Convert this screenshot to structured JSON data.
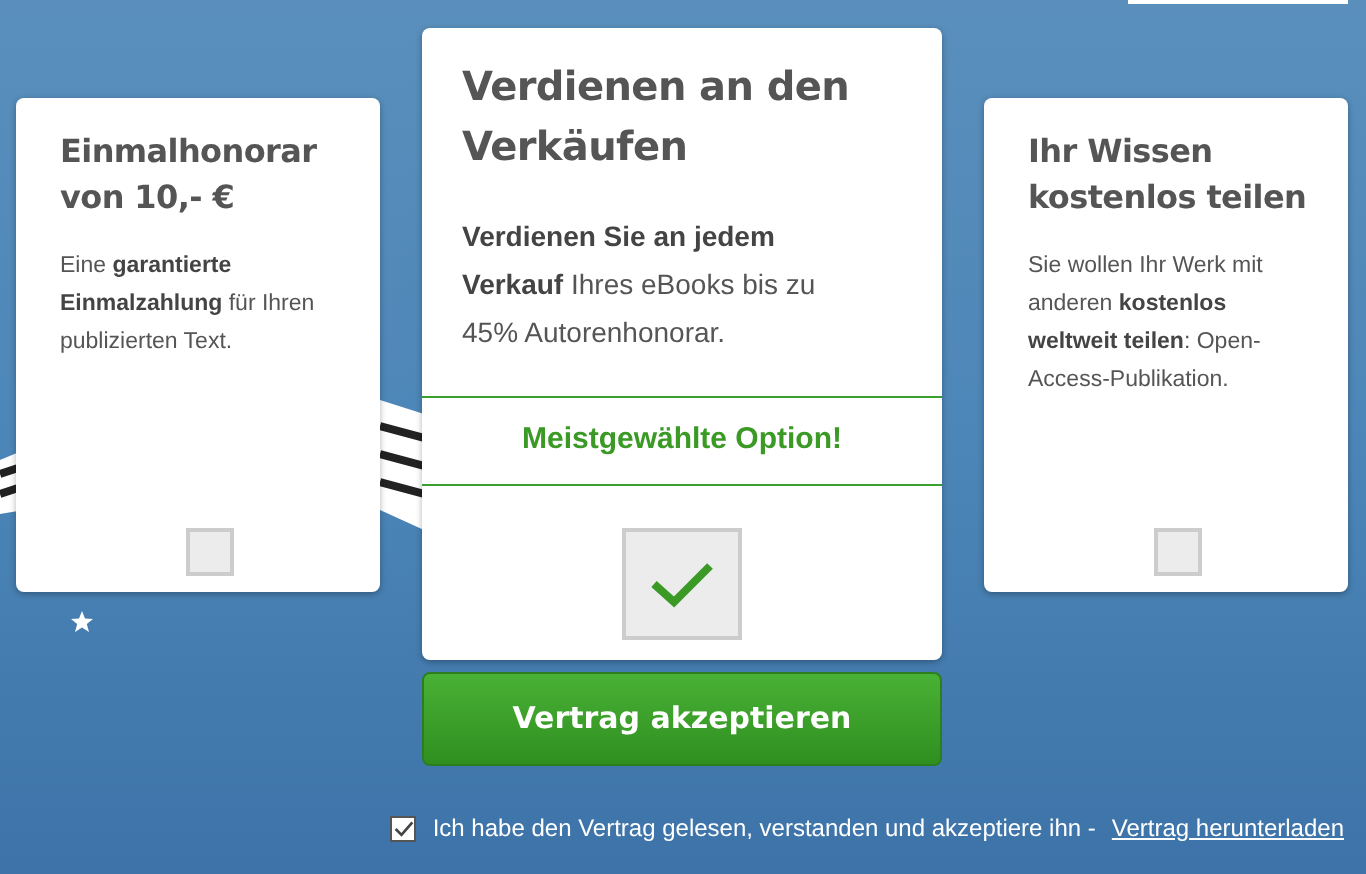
{
  "options": [
    {
      "kind": "standard",
      "title": "Einmalhonorar von 10,- €",
      "description": "Eine **garantierte Einmalzahlung** für Ihren publizierten Text.",
      "selected": false
    },
    {
      "kind": "featured",
      "title": "Verdienen an den Verkäufen",
      "description": "**Verdienen Sie an jedem Verkauf** Ihres eBooks bis zu 45% Autorenhonorar.",
      "badge": "Meistgewählte Option!",
      "selected": true
    },
    {
      "kind": "standard",
      "title": "Ihr Wissen kostenlos teilen",
      "description": "Sie wollen Ihr Werk mit anderen **kostenlos weltweit teilen**: Open-Access-Publikation.",
      "selected": false
    }
  ],
  "accept_button": "Vertrag akzeptieren",
  "agreement": {
    "checked": true,
    "text": "Ich habe den Vertrag gelesen, verstanden und akzeptiere ihn -",
    "link": "Vertrag herunterladen"
  }
}
